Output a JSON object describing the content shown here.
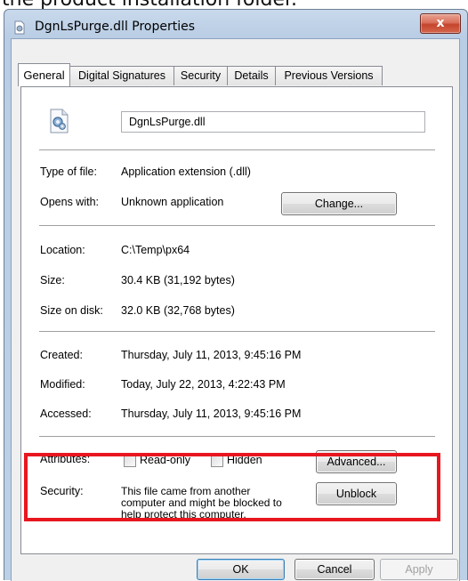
{
  "caption": "the product installation folder.",
  "window": {
    "title": "DgnLsPurge.dll Properties",
    "close_label": "x"
  },
  "tabs": [
    "General",
    "Digital Signatures",
    "Security",
    "Details",
    "Previous Versions"
  ],
  "general": {
    "file_name": "DgnLsPurge.dll",
    "type_label": "Type of file:",
    "type_value": "Application extension (.dll)",
    "opens_label": "Opens with:",
    "opens_value": "Unknown application",
    "change_button": "Change...",
    "location_label": "Location:",
    "location_value": "C:\\Temp\\px64",
    "size_label": "Size:",
    "size_value": "30.4 KB (31,192 bytes)",
    "size_disk_label": "Size on disk:",
    "size_disk_value": "32.0 KB (32,768 bytes)",
    "created_label": "Created:",
    "created_value": "Thursday, July 11, 2013, 9:45:16 PM",
    "modified_label": "Modified:",
    "modified_value": "Today, July 22, 2013, 4:22:43 PM",
    "accessed_label": "Accessed:",
    "accessed_value": "Thursday, July 11, 2013, 9:45:16 PM",
    "attributes_label": "Attributes:",
    "readonly_label": "Read-only",
    "hidden_label": "Hidden",
    "advanced_button": "Advanced...",
    "security_label": "Security:",
    "security_line1": "This file came from another",
    "security_line2": "computer and might be blocked to",
    "security_line3": "help protect this computer.",
    "unblock_button": "Unblock"
  },
  "footer": {
    "ok_button": "OK",
    "cancel_button": "Cancel",
    "apply_button": "Apply"
  },
  "colors": {
    "highlight_border": "#e8171f",
    "close_button": "#c4452d"
  },
  "icons": [
    "file-icon",
    "title-file-icon"
  ]
}
